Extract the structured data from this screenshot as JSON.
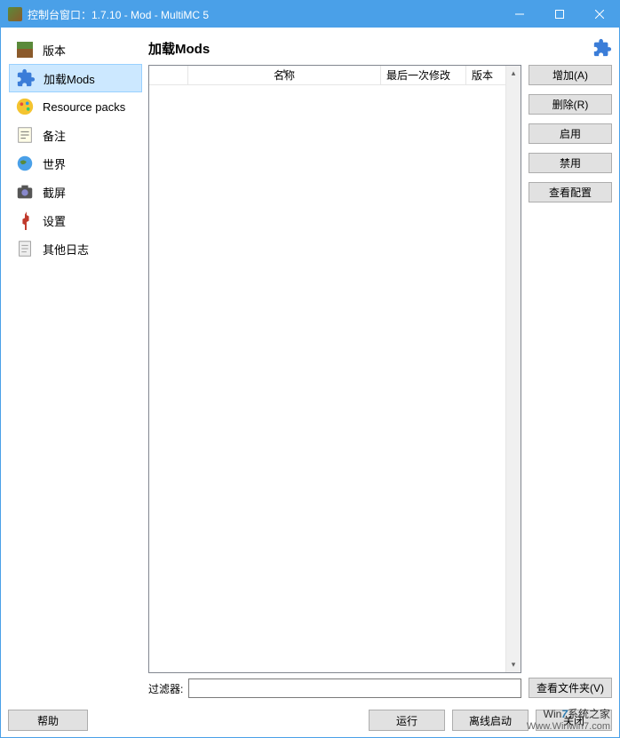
{
  "window": {
    "title": "控制台窗口：1.7.10 - Mod - MultiMC 5"
  },
  "sidebar": {
    "items": [
      {
        "label": "版本"
      },
      {
        "label": "加载Mods"
      },
      {
        "label": "Resource packs"
      },
      {
        "label": "备注"
      },
      {
        "label": "世界"
      },
      {
        "label": "截屏"
      },
      {
        "label": "设置"
      },
      {
        "label": "其他日志"
      }
    ]
  },
  "main": {
    "title": "加载Mods",
    "columns": {
      "name": "名称",
      "modified": "最后一次修改",
      "version": "版本"
    },
    "filter_label": "过滤器:",
    "filter_value": ""
  },
  "buttons": {
    "add": "增加(A)",
    "remove": "删除(R)",
    "enable": "启用",
    "disable": "禁用",
    "view_config": "查看配置",
    "view_folder": "查看文件夹(V)"
  },
  "footer": {
    "help": "帮助",
    "run": "运行",
    "offline": "离线启动",
    "close": "关闭"
  },
  "watermark": {
    "line1a": "Win",
    "line1b": "7",
    "line1c": "系统之家",
    "line2": "Www.Winwin7.com"
  }
}
